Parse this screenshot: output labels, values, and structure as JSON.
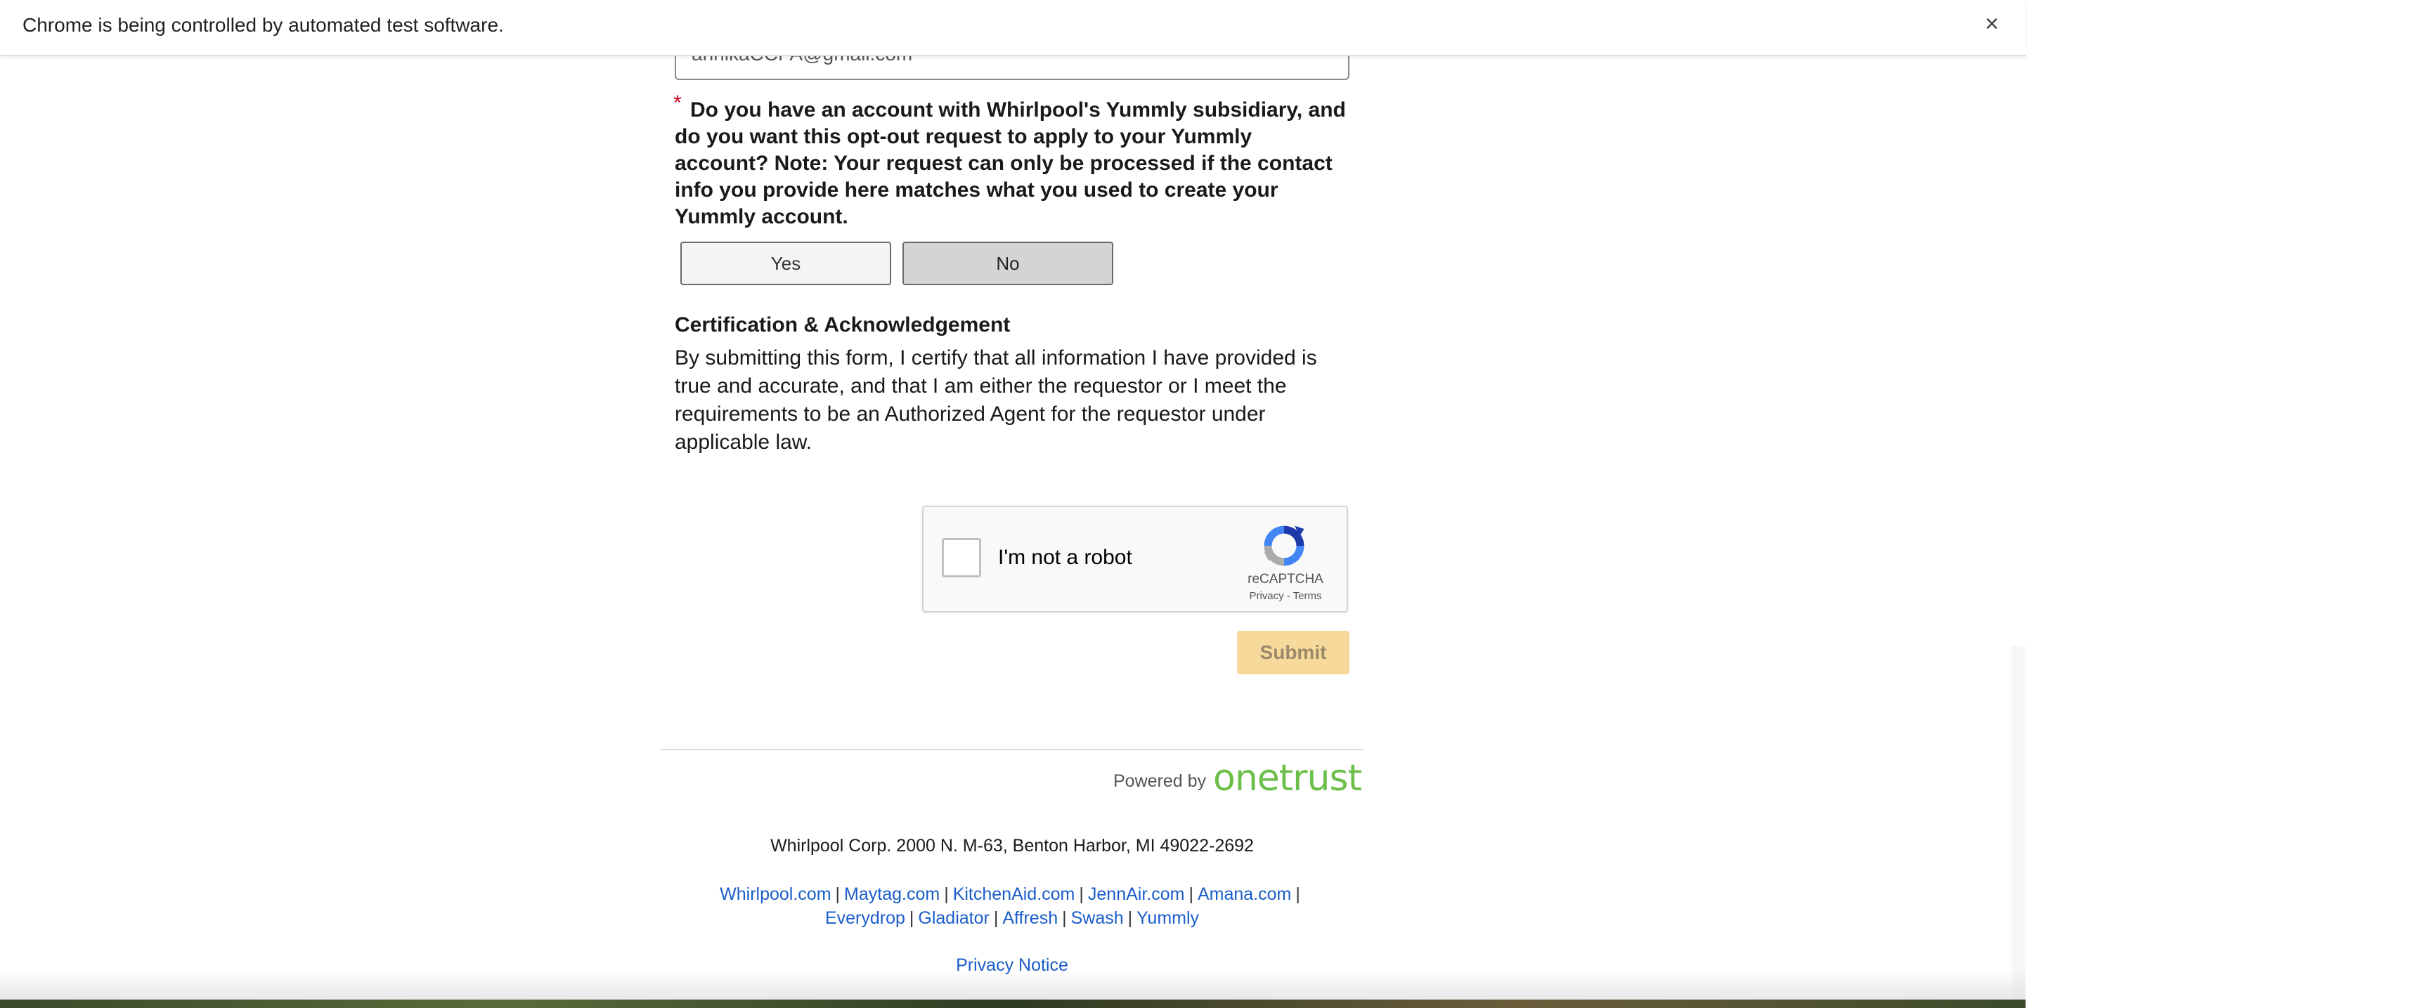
{
  "infobar": {
    "message": "Chrome is being controlled by automated test software.",
    "close_glyph": "×"
  },
  "form": {
    "email_value": "annikaCCPA@gmail.com",
    "required_marker": "*",
    "yummly_question_line1": "Do you have an account with Whirlpool's Yummly subsidiary, and do you want this opt-out request to apply to your Yummly account? Note: Your request can only be processed if the contact info you provide here matches what you used to create your Yummly account.",
    "yes_label": "Yes",
    "no_label": "No",
    "selected_option": "No",
    "certification_title": "Certification & Acknowledgement",
    "certification_body": "By submitting this form, I certify that all information I have provided is true and accurate, and that I am either the requestor or I meet the requirements to be an Authorized Agent for the requestor under applicable law.",
    "submit_label": "Submit"
  },
  "recaptcha": {
    "label": "I'm not a robot",
    "brand": "reCAPTCHA",
    "links": "Privacy - Terms",
    "icon": "recaptcha-logo-icon"
  },
  "footer": {
    "powered_by": "Powered by",
    "logo_text": "onetrust",
    "address": "Whirlpool Corp. 2000 N. M-63, Benton Harbor, MI 49022-2692",
    "links_row1": [
      "Whirlpool.com",
      "Maytag.com",
      "KitchenAid.com",
      "JennAir.com",
      "Amana.com"
    ],
    "links_row2": [
      "Everydrop",
      "Gladiator",
      "Affresh",
      "Swash",
      "Yummly"
    ],
    "separator": "|",
    "privacy_notice": "Privacy Notice"
  },
  "colors": {
    "link": "#1a5dc9",
    "submit_bg": "#f7d99b",
    "onetrust_green": "#6cc04a",
    "required_red": "#d0021b"
  }
}
